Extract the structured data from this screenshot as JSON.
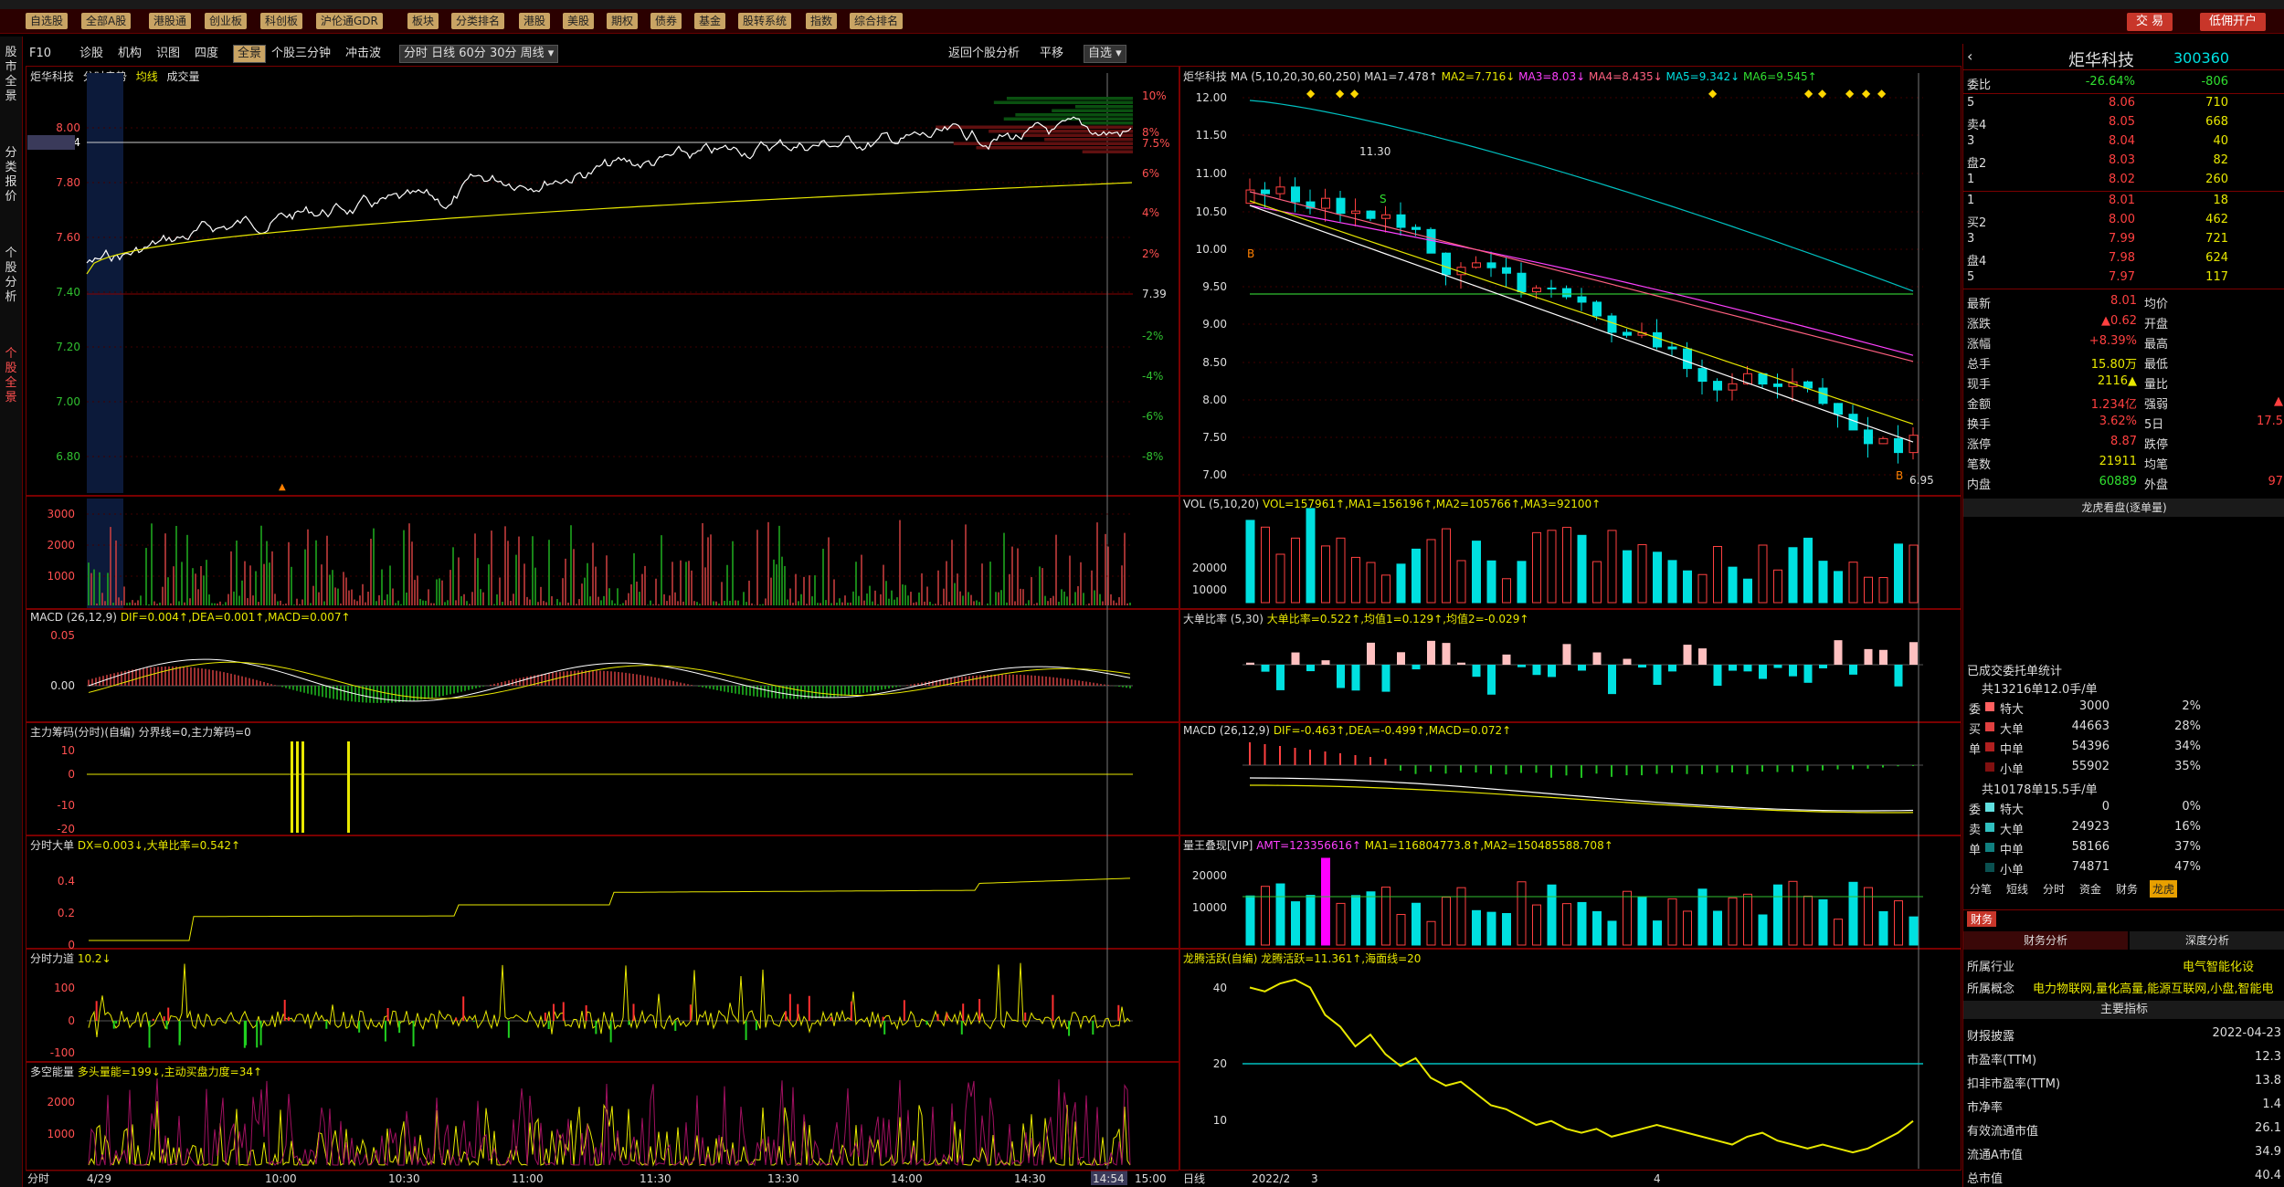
{
  "toolbar": {
    "buttons": [
      "自选股",
      "全部A股",
      "港股通",
      "创业板",
      "科创板",
      "沪伦通GDR",
      "板块",
      "分类排名",
      "港股",
      "美股",
      "期权",
      "债券",
      "基金",
      "股转系统",
      "指数",
      "综合排名"
    ],
    "right_buttons": [
      "交 易",
      "低佣开户"
    ]
  },
  "sidebar": {
    "tabs": [
      "股市全景",
      "分类报价",
      "个股分析",
      "个股全景"
    ]
  },
  "subbar": {
    "items": [
      "F10",
      "诊股",
      "机构",
      "识图",
      "四度",
      "全景",
      "个股三分钟",
      "冲击波"
    ],
    "periods": [
      "分时",
      "日线",
      "60分",
      "30分",
      "周线"
    ],
    "right_items": [
      "返回个股分析",
      "平移",
      "自选"
    ]
  },
  "left": {
    "title": "炬华科技",
    "title_tabs": [
      "分时走势",
      "均线",
      "成交量"
    ],
    "price_labels": [
      "8.00",
      "7.94",
      "7.80",
      "7.60",
      "7.40",
      "7.20",
      "7.00",
      "6.80"
    ],
    "pct_labels": [
      "10%",
      "8%",
      "7.5%",
      "6%",
      "4%",
      "2%",
      "7.39",
      "-2%",
      "-4%",
      "-6%",
      "-8%"
    ],
    "vol_labels": [
      "3000",
      "2000",
      "1000"
    ],
    "macd_title": "MACD",
    "macd_params": "(26,12,9)",
    "macd_vals": "DIF=0.004↑,DEA=0.001↑,MACD=0.007↑",
    "macd_labels": [
      "0.05",
      "0.00"
    ],
    "chip_title": "主力筹码(分时)(自编)",
    "chip_vals": "分界线=0,主力筹码=0",
    "chip_labels": [
      "10",
      "0",
      "-10",
      "-20"
    ],
    "bigorder_title": "分时大单",
    "bigorder_vals": "DX=0.003↓,大单比率=0.542↑",
    "bigorder_labels": [
      "0.4",
      "0.2",
      "0"
    ],
    "force_title": "分时力道",
    "force_vals": "10.2↓",
    "force_labels": [
      "100",
      "0",
      "-100"
    ],
    "longshort_title": "多空能量",
    "longshort_vals": "多头量能=199↓,主动买盘力度=34↑",
    "longshort_labels": [
      "2000",
      "1000"
    ],
    "x_labels": [
      "分时",
      "4/29",
      "10:00",
      "10:30",
      "11:00",
      "11:30",
      "13:30",
      "14:00",
      "14:30",
      "14:54",
      "15:00"
    ]
  },
  "mid": {
    "title": "炬华科技",
    "ma_title": "MA",
    "ma_params": "(5,10,20,30,60,250)",
    "ma_vals": [
      "MA1=7.478↑",
      "MA2=7.716↓",
      "MA3=8.03↓",
      "MA4=8.435↓",
      "MA5=9.342↓",
      "MA6=9.545↑"
    ],
    "price_labels": [
      "12.00",
      "11.50",
      "11.00",
      "10.50",
      "10.00",
      "9.50",
      "9.00",
      "8.50",
      "8.00",
      "7.50",
      "7.00"
    ],
    "high_mark": "11.30",
    "low_mark": "6.95",
    "vol_title": "VOL",
    "vol_params": "(5,10,20)",
    "vol_vals": "VOL=157961↑,MA1=156196↑,MA2=105766↑,MA3=92100↑",
    "vol_labels": [
      "20000",
      "10000"
    ],
    "big_title": "大单比率",
    "big_params": "(5,30)",
    "big_vals": "大单比率=0.522↑,均值1=0.129↑,均值2=-0.029↑",
    "macd_title": "MACD",
    "macd_params": "(26,12,9)",
    "macd_vals": "DIF=-0.463↑,DEA=-0.499↑,MACD=0.072↑",
    "amt_title": "量王叠现[VIP]",
    "amt_vals_a": "AMT=123356616↑",
    "amt_vals_b": "MA1=116804773.8↑,MA2=150485588.708↑",
    "amt_labels": [
      "20000",
      "10000"
    ],
    "dragon_title": "龙腾活跃(自编)",
    "dragon_vals": "龙腾活跃=11.361↑,海面线=20",
    "dragon_labels": [
      "40",
      "20",
      "10"
    ],
    "x_labels": [
      "日线",
      "2022/2",
      "3",
      "4"
    ],
    "markers": [
      "B",
      "S",
      "B"
    ]
  },
  "right": {
    "stock_name": "炬华科技",
    "stock_code": "300360",
    "webi": {
      "label": "委比",
      "pct": "-26.64%",
      "val": "-806"
    },
    "asks": [
      {
        "label": "5",
        "price": "8.06",
        "vol": "710"
      },
      {
        "label": "卖4",
        "price": "8.05",
        "vol": "668"
      },
      {
        "label": "3",
        "price": "8.04",
        "vol": "40"
      },
      {
        "label": "盘2",
        "price": "8.03",
        "vol": "82"
      },
      {
        "label": "1",
        "price": "8.02",
        "vol": "260"
      }
    ],
    "bids": [
      {
        "label": "1",
        "price": "8.01",
        "vol": "18"
      },
      {
        "label": "买2",
        "price": "8.00",
        "vol": "462"
      },
      {
        "label": "3",
        "price": "7.99",
        "vol": "721"
      },
      {
        "label": "盘4",
        "price": "7.98",
        "vol": "624"
      },
      {
        "label": "5",
        "price": "7.97",
        "vol": "117"
      }
    ],
    "stats": [
      {
        "l": "最新",
        "v": "8.01",
        "l2": "均价",
        "v2": ""
      },
      {
        "l": "涨跌",
        "v": "▲0.62",
        "l2": "开盘",
        "v2": ""
      },
      {
        "l": "涨幅",
        "v": "+8.39%",
        "l2": "最高",
        "v2": ""
      },
      {
        "l": "总手",
        "v": "15.80万",
        "l2": "最低",
        "v2": ""
      },
      {
        "l": "现手",
        "v": "2116▲",
        "l2": "量比",
        "v2": ""
      },
      {
        "l": "金额",
        "v": "1.234亿",
        "l2": "强弱",
        "v2": "▲"
      },
      {
        "l": "换手",
        "v": "3.62%",
        "l2": "5日",
        "v2": "17.5"
      },
      {
        "l": "涨停",
        "v": "8.87",
        "l2": "跌停",
        "v2": ""
      },
      {
        "l": "笔数",
        "v": "21911",
        "l2": "均笔",
        "v2": ""
      },
      {
        "l": "内盘",
        "v": "60889",
        "l2": "外盘",
        "v2": "97"
      }
    ],
    "dragon_title": "龙虎看盘(逐单量)",
    "done_title": "已成交委托单统计",
    "buy_total": "共13216单12.0手/单",
    "buy_rows": [
      {
        "side": "委",
        "name": "特大",
        "v": "3000",
        "p": "2%"
      },
      {
        "side": "买",
        "name": "大单",
        "v": "44663",
        "p": "28%"
      },
      {
        "side": "单",
        "name": "中单",
        "v": "54396",
        "p": "34%"
      },
      {
        "side": "",
        "name": "小单",
        "v": "55902",
        "p": "35%"
      }
    ],
    "sell_total": "共10178单15.5手/单",
    "sell_rows": [
      {
        "side": "委",
        "name": "特大",
        "v": "0",
        "p": "0%"
      },
      {
        "side": "卖",
        "name": "大单",
        "v": "24923",
        "p": "16%"
      },
      {
        "side": "单",
        "name": "中单",
        "v": "58166",
        "p": "37%"
      },
      {
        "side": "",
        "name": "小单",
        "v": "74871",
        "p": "47%"
      }
    ],
    "tabs": [
      "分笔",
      "短线",
      "分时",
      "资金",
      "财务",
      "龙虎"
    ],
    "fin_tab": "财务",
    "fin_subtabs": [
      "财务分析",
      "深度分析"
    ],
    "industry_label": "所属行业",
    "industry": "电气智能化设",
    "concept_label": "所属概念",
    "concept": "电力物联网,量化高量,能源互联网,小盘,智能电",
    "main_index": "主要指标",
    "fin_rows": [
      {
        "l": "财报披露",
        "v": "2022-04-23"
      },
      {
        "l": "市盈率(TTM)",
        "v": "12.3"
      },
      {
        "l": "扣非市盈率(TTM)",
        "v": "13.8"
      },
      {
        "l": "市净率",
        "v": "1.4"
      },
      {
        "l": "有效流通市值",
        "v": "26.1"
      },
      {
        "l": "流通A市值",
        "v": "34.9"
      },
      {
        "l": "总市值",
        "v": "40.4"
      }
    ],
    "pie": [
      {
        "name": "特大买",
        "value": 2,
        "color": "#ff6060"
      },
      {
        "name": "大单买",
        "value": 28,
        "color": "#e04040"
      },
      {
        "name": "中单买",
        "value": 34,
        "color": "#b02020"
      },
      {
        "name": "小单买",
        "value": 35,
        "color": "#801010"
      },
      {
        "name": "大单卖",
        "value": 16,
        "color": "#30c0c0"
      },
      {
        "name": "中单卖",
        "value": 37,
        "color": "#108080"
      },
      {
        "name": "小单卖",
        "value": 47,
        "color": "#0a5050"
      }
    ]
  },
  "colors": {
    "up": "#ff4040",
    "down": "#00e0e0",
    "accent": "#c9a464",
    "border": "#7a0000"
  }
}
